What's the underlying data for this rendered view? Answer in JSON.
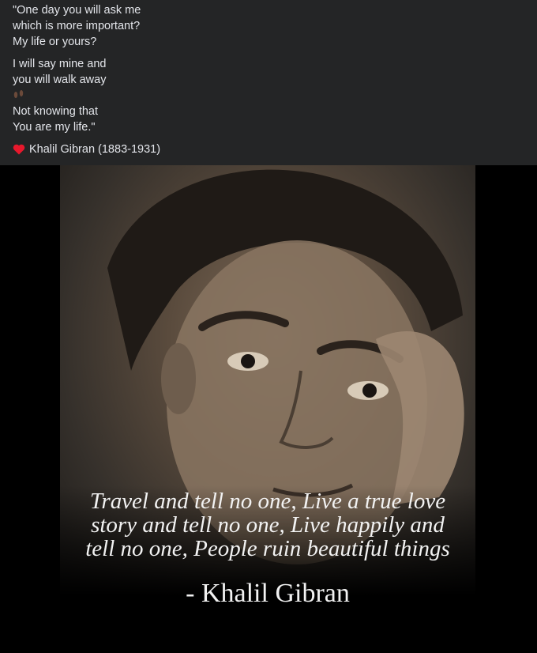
{
  "post": {
    "para1": [
      "\"One day you will ask me",
      "which is more important?",
      "My life or yours?"
    ],
    "para2": [
      "I will say mine and",
      "you will walk away"
    ],
    "para3": [
      "Not knowing that",
      "You are my life.\""
    ],
    "emoji_icon": "footprints-icon",
    "author": "Khalil Gibran (1883-1931)",
    "author_icon": "heart-icon",
    "heart_color": "#e8182c"
  },
  "image": {
    "quote_lines": [
      "Travel and tell no one, Live a true love",
      "story and tell no one, Live happily and",
      "tell no one, People ruin beautiful things"
    ],
    "attribution": "- Khalil Gibran"
  }
}
